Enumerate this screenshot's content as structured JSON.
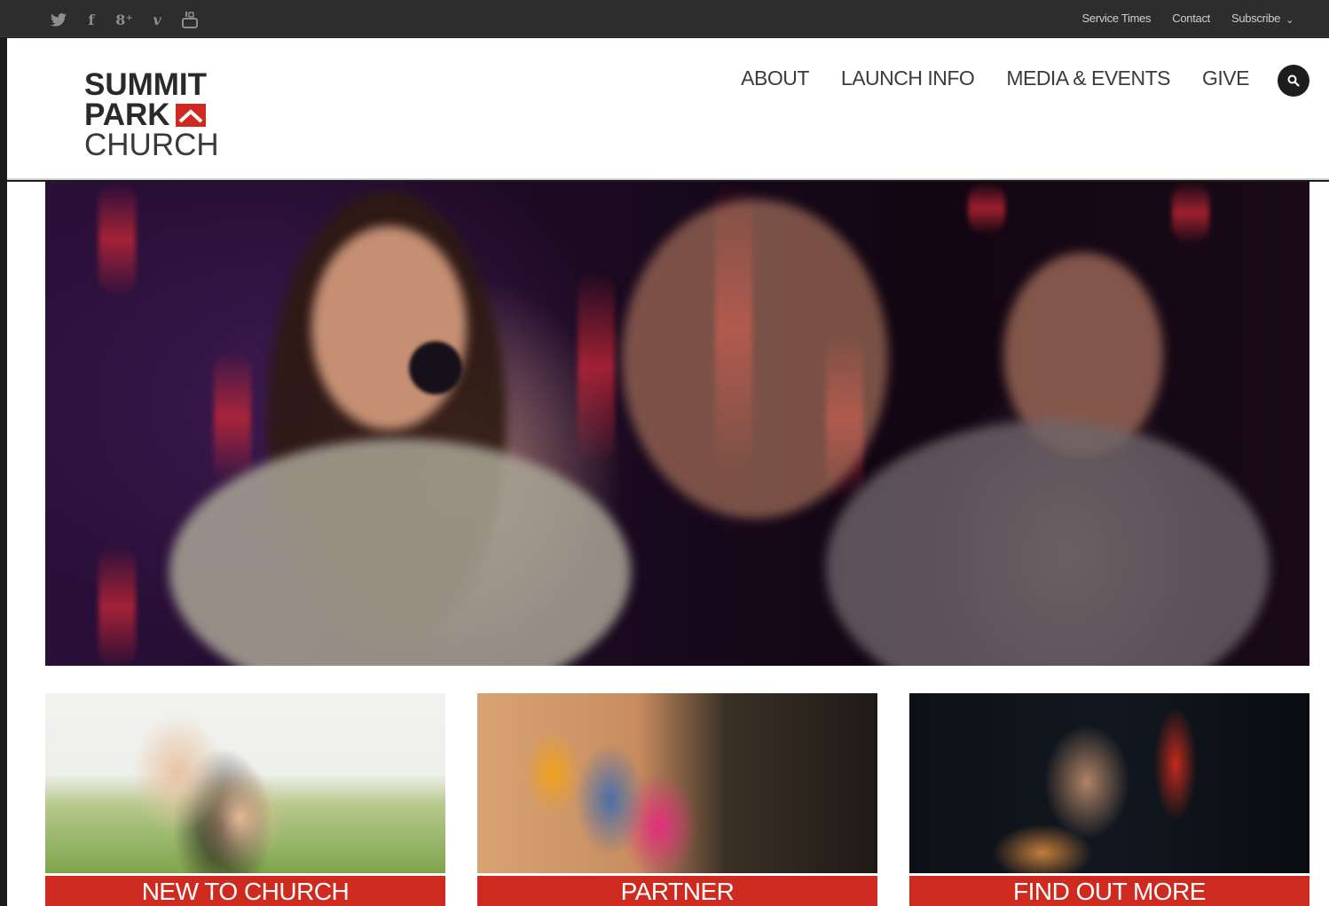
{
  "topbar": {
    "social_icons": [
      "twitter-icon",
      "facebook-icon",
      "google-plus-icon",
      "vimeo-icon",
      "youtube-icon"
    ],
    "social_glyphs": {
      "facebook": "f",
      "google_plus": "8⁺",
      "vimeo": "v"
    },
    "links": {
      "service_times": "Service Times",
      "contact": "Contact",
      "subscribe": "Subscribe"
    }
  },
  "header": {
    "logo": {
      "line1": "SUMMIT",
      "line2": "PARK",
      "line3": "CHURCH",
      "mark_color": "#cf2a1f"
    },
    "nav": [
      {
        "label": "ABOUT"
      },
      {
        "label": "LAUNCH INFO"
      },
      {
        "label": "MEDIA & EVENTS"
      },
      {
        "label": "GIVE"
      }
    ]
  },
  "tiles": [
    {
      "label": "NEW TO CHURCH"
    },
    {
      "label": "PARTNER"
    },
    {
      "label": "FIND OUT MORE"
    }
  ],
  "colors": {
    "accent_red": "#cf2a1f",
    "topbar_bg": "#2d2d2d",
    "nav_text": "#3c3c3c"
  }
}
